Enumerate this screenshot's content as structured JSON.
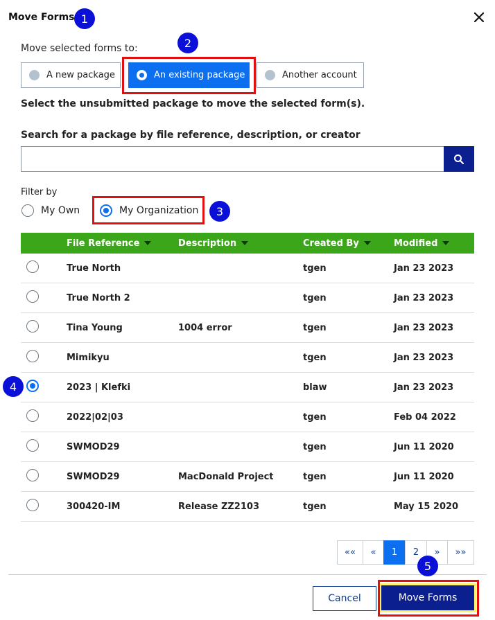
{
  "dialog": {
    "title": "Move Forms",
    "close_icon": "close-icon"
  },
  "move_to": {
    "label": "Move selected forms to:",
    "options": [
      {
        "label": "A new package",
        "selected": false
      },
      {
        "label": "An existing package",
        "selected": true
      },
      {
        "label": "Another account",
        "selected": false
      }
    ]
  },
  "instruction": "Select the unsubmitted package to move the selected form(s).",
  "search": {
    "label": "Search for a package by file reference, description, or creator",
    "value": "",
    "placeholder": "",
    "icon": "search-icon"
  },
  "filter": {
    "label": "Filter by",
    "options": [
      {
        "label": "My Own",
        "selected": false
      },
      {
        "label": "My Organization",
        "selected": true
      }
    ]
  },
  "table": {
    "columns": [
      "File Reference",
      "Description",
      "Created By",
      "Modified"
    ],
    "rows": [
      {
        "ref": "True North",
        "desc": "",
        "by": "tgen",
        "mod": "Jan 23 2023",
        "selected": false
      },
      {
        "ref": "True North 2",
        "desc": "",
        "by": "tgen",
        "mod": "Jan 23 2023",
        "selected": false
      },
      {
        "ref": "Tina Young",
        "desc": "1004 error",
        "by": "tgen",
        "mod": "Jan 23 2023",
        "selected": false
      },
      {
        "ref": "Mimikyu",
        "desc": "",
        "by": "tgen",
        "mod": "Jan 23 2023",
        "selected": false
      },
      {
        "ref": "2023 | Klefki",
        "desc": "",
        "by": "blaw",
        "mod": "Jan 23 2023",
        "selected": true
      },
      {
        "ref": "2022|02|03",
        "desc": "",
        "by": "tgen",
        "mod": "Feb 04 2022",
        "selected": false
      },
      {
        "ref": "SWMOD29",
        "desc": "",
        "by": "tgen",
        "mod": "Jun 11 2020",
        "selected": false
      },
      {
        "ref": "SWMOD29",
        "desc": "MacDonald Project",
        "by": "tgen",
        "mod": "Jun 11 2020",
        "selected": false
      },
      {
        "ref": "300420-IM",
        "desc": "Release ZZ2103",
        "by": "tgen",
        "mod": "May 15 2020",
        "selected": false
      }
    ]
  },
  "pagination": {
    "first": "««",
    "prev": "«",
    "pages": [
      "1",
      "2"
    ],
    "current": "1",
    "next": "»",
    "last": "»»"
  },
  "footer": {
    "cancel_label": "Cancel",
    "move_label": "Move Forms"
  },
  "callouts": [
    "1",
    "2",
    "3",
    "4",
    "5"
  ],
  "colors": {
    "accent": "#0b6ff0",
    "header_green": "#3ba61a",
    "primary_button": "#0b1f8f",
    "highlight": "#e01010",
    "callout": "#0a10d8"
  }
}
